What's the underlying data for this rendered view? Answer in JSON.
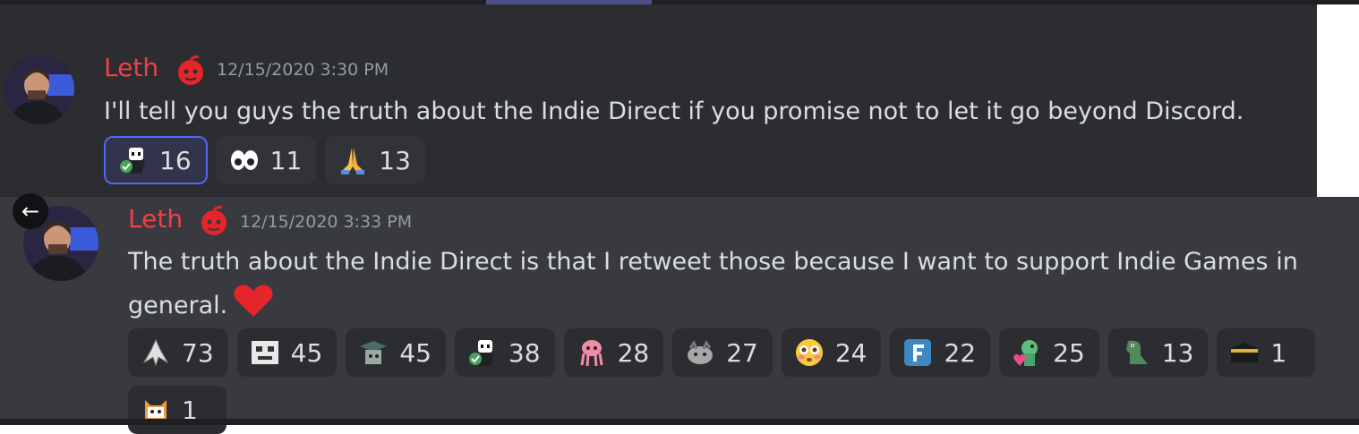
{
  "messages": [
    {
      "username": "Leth",
      "timestamp": "12/15/2020 3:30 PM",
      "content": "I'll tell you guys the truth about the Indie Direct if you promise not to let it go beyond Discord.",
      "reactions": [
        {
          "emoji": "checkmark-figure-emoji",
          "count": "16"
        },
        {
          "emoji": "eyes-emoji",
          "count": "11"
        },
        {
          "emoji": "folded-hands-emoji",
          "count": "13"
        }
      ]
    },
    {
      "username": "Leth",
      "timestamp": "12/15/2020 3:33 PM",
      "content": "The truth about the Indie Direct is that I retweet those because I want to support Indie Games in general.",
      "inline_emoji": "red-heart-emoji",
      "reactions": [
        {
          "emoji": "winged-emblem-emoji",
          "count": "73"
        },
        {
          "emoji": "pixel-face-emoji",
          "count": "45"
        },
        {
          "emoji": "grad-cap-emoji",
          "count": "45"
        },
        {
          "emoji": "checkmark-figure-emoji",
          "count": "38"
        },
        {
          "emoji": "pink-squid-emoji",
          "count": "28"
        },
        {
          "emoji": "gray-creature-emoji",
          "count": "27"
        },
        {
          "emoji": "flushed-face-emoji",
          "count": "24"
        },
        {
          "emoji": "letter-f-emoji",
          "count": "22"
        },
        {
          "emoji": "green-heart-character-emoji",
          "count": "25"
        },
        {
          "emoji": "green-dino-emoji",
          "count": "13"
        },
        {
          "emoji": "kaaba-emoji",
          "count": "1"
        },
        {
          "emoji": "orange-cat-emoji",
          "count": "1"
        }
      ]
    }
  ],
  "colors": {
    "username": "#f23f43",
    "accent": "#5865f2",
    "heart": "#e5252a"
  }
}
